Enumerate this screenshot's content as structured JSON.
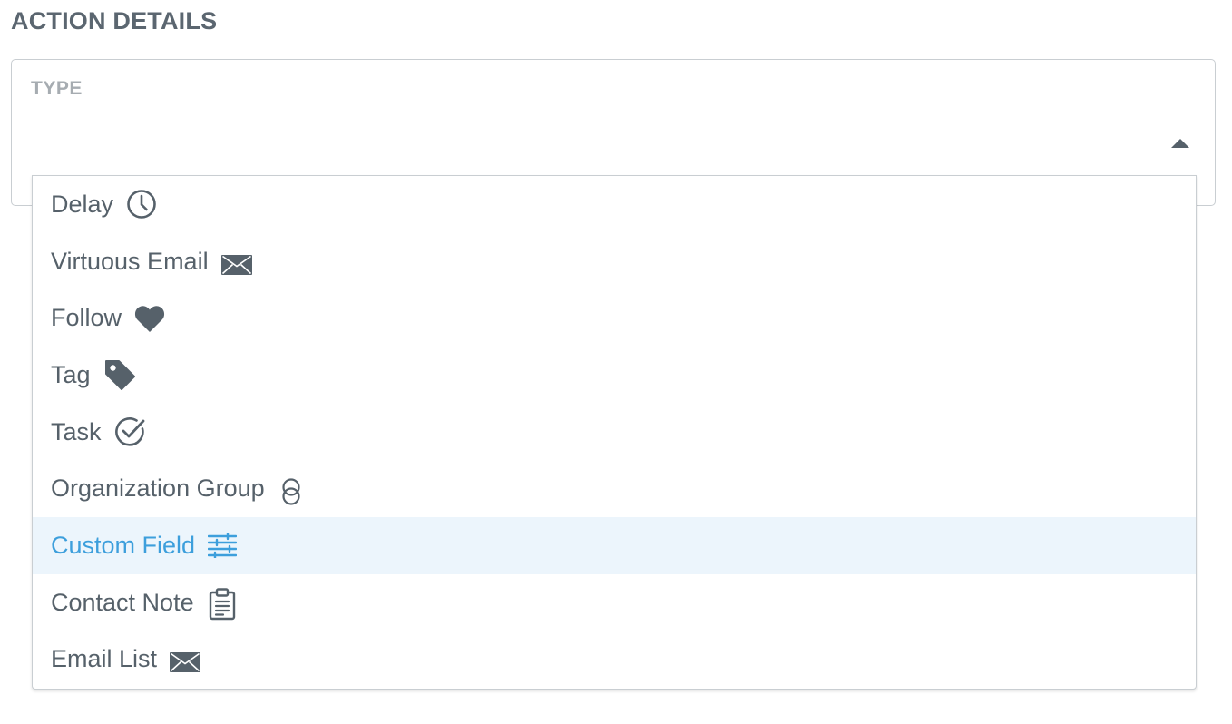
{
  "section": {
    "title": "ACTION DETAILS"
  },
  "type_field": {
    "label": "TYPE",
    "selected_value": ""
  },
  "dropdown": {
    "highlighted_index": 6,
    "options": [
      {
        "label": "Delay",
        "icon": "clock-icon"
      },
      {
        "label": "Virtuous Email",
        "icon": "envelope-icon"
      },
      {
        "label": "Follow",
        "icon": "heart-icon"
      },
      {
        "label": "Tag",
        "icon": "tag-icon"
      },
      {
        "label": "Task",
        "icon": "check-circle-icon"
      },
      {
        "label": "Organization Group",
        "icon": "linked-rings-icon"
      },
      {
        "label": "Custom Field",
        "icon": "sliders-icon"
      },
      {
        "label": "Contact Note",
        "icon": "clipboard-icon"
      },
      {
        "label": "Email List",
        "icon": "envelope-icon"
      }
    ]
  },
  "colors": {
    "text": "#56616a",
    "muted_label": "#a6acb1",
    "border": "#c9ced2",
    "highlight_bg": "#ecf5fc",
    "highlight_text": "#3d9fdc"
  }
}
